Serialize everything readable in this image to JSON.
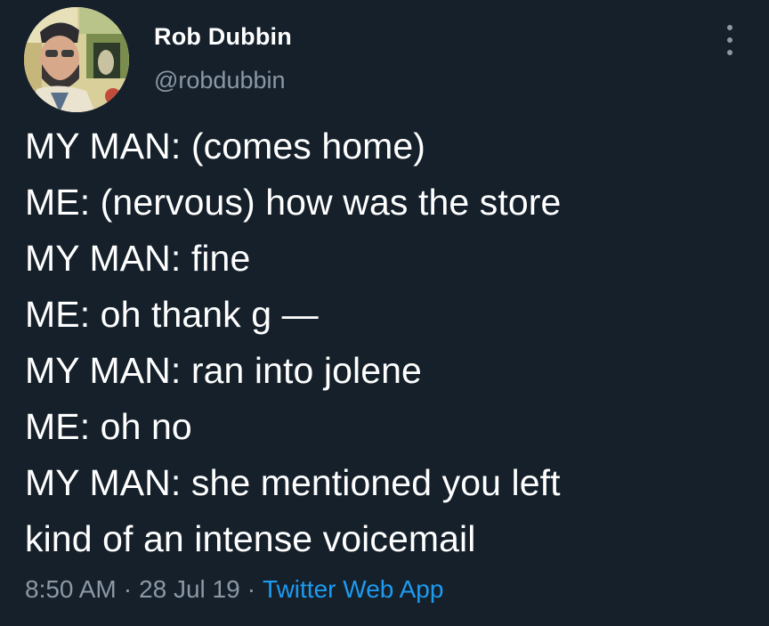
{
  "tweet": {
    "author": {
      "display_name": "Rob Dubbin",
      "handle": "@robdubbin",
      "avatar_icon": "user-avatar-illustration"
    },
    "more_icon": "more-options-icon",
    "lines": [
      "MY MAN: (comes home)",
      "ME: (nervous) how was the store",
      "MY MAN: fine",
      "ME: oh thank g —",
      "MY MAN: ran into jolene",
      "ME: oh no",
      "MY MAN: she mentioned you left",
      "kind of an intense voicemail"
    ],
    "meta": {
      "time": "8:50 AM",
      "separator": "·",
      "date": "28 Jul 19",
      "source": "Twitter Web App"
    }
  },
  "colors": {
    "background": "#15202b",
    "text_primary": "#ffffff",
    "text_secondary": "#8b98a5",
    "link": "#1d9bf0"
  }
}
